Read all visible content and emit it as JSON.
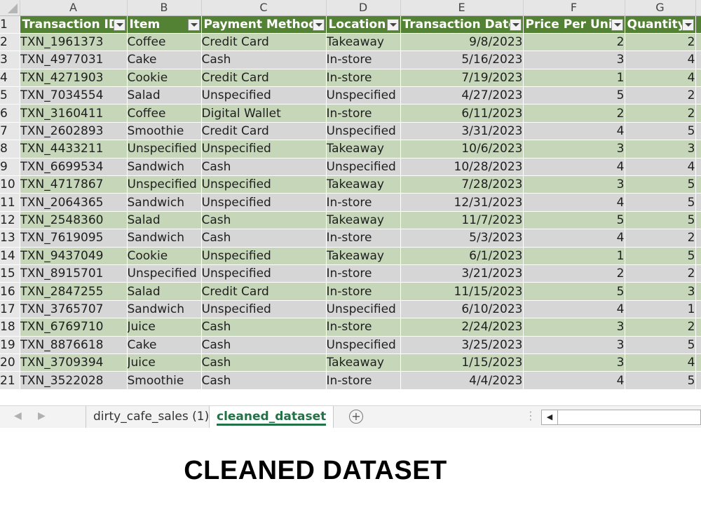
{
  "column_letters": [
    "A",
    "B",
    "C",
    "D",
    "E",
    "F",
    "G"
  ],
  "headers": [
    "Transaction ID",
    "Item",
    "Payment Method",
    "Location",
    "Transaction Date",
    "Price Per Unit",
    "Quantity"
  ],
  "row_numbers": [
    "1",
    "2",
    "3",
    "4",
    "5",
    "6",
    "7",
    "8",
    "9",
    "10",
    "11",
    "12",
    "13",
    "14",
    "15",
    "16",
    "17",
    "18",
    "19",
    "20",
    "21"
  ],
  "rows": [
    [
      "TXN_1961373",
      "Coffee",
      "Credit Card",
      "Takeaway",
      "9/8/2023",
      "2",
      "2"
    ],
    [
      "TXN_4977031",
      "Cake",
      "Cash",
      "In-store",
      "5/16/2023",
      "3",
      "4"
    ],
    [
      "TXN_4271903",
      "Cookie",
      "Credit Card",
      "In-store",
      "7/19/2023",
      "1",
      "4"
    ],
    [
      "TXN_7034554",
      "Salad",
      "Unspecified",
      "Unspecified",
      "4/27/2023",
      "5",
      "2"
    ],
    [
      "TXN_3160411",
      "Coffee",
      "Digital Wallet",
      "In-store",
      "6/11/2023",
      "2",
      "2"
    ],
    [
      "TXN_2602893",
      "Smoothie",
      "Credit Card",
      "Unspecified",
      "3/31/2023",
      "4",
      "5"
    ],
    [
      "TXN_4433211",
      "Unspecified",
      "Unspecified",
      "Takeaway",
      "10/6/2023",
      "3",
      "3"
    ],
    [
      "TXN_6699534",
      "Sandwich",
      "Cash",
      "Unspecified",
      "10/28/2023",
      "4",
      "4"
    ],
    [
      "TXN_4717867",
      "Unspecified",
      "Unspecified",
      "Takeaway",
      "7/28/2023",
      "3",
      "5"
    ],
    [
      "TXN_2064365",
      "Sandwich",
      "Unspecified",
      "In-store",
      "12/31/2023",
      "4",
      "5"
    ],
    [
      "TXN_2548360",
      "Salad",
      "Cash",
      "Takeaway",
      "11/7/2023",
      "5",
      "5"
    ],
    [
      "TXN_7619095",
      "Sandwich",
      "Cash",
      "In-store",
      "5/3/2023",
      "4",
      "2"
    ],
    [
      "TXN_9437049",
      "Cookie",
      "Unspecified",
      "Takeaway",
      "6/1/2023",
      "1",
      "5"
    ],
    [
      "TXN_8915701",
      "Unspecified",
      "Unspecified",
      "In-store",
      "3/21/2023",
      "2",
      "2"
    ],
    [
      "TXN_2847255",
      "Salad",
      "Credit Card",
      "In-store",
      "11/15/2023",
      "5",
      "3"
    ],
    [
      "TXN_3765707",
      "Sandwich",
      "Unspecified",
      "Unspecified",
      "6/10/2023",
      "4",
      "1"
    ],
    [
      "TXN_6769710",
      "Juice",
      "Cash",
      "In-store",
      "2/24/2023",
      "3",
      "2"
    ],
    [
      "TXN_8876618",
      "Cake",
      "Cash",
      "Unspecified",
      "3/25/2023",
      "3",
      "5"
    ],
    [
      "TXN_3709394",
      "Juice",
      "Cash",
      "Takeaway",
      "1/15/2023",
      "3",
      "4"
    ],
    [
      "TXN_3522028",
      "Smoothie",
      "Cash",
      "In-store",
      "4/4/2023",
      "4",
      "5"
    ]
  ],
  "tabs": {
    "sheet1": "dirty_cafe_sales (1)",
    "sheet2": "cleaned_dataset",
    "add_icon": "plus-circle-icon"
  },
  "caption": "CLEANED DATASET",
  "colors": {
    "header_green": "#548235",
    "band_green": "#c6d6b9",
    "band_gray": "#d6d6d6",
    "active_tab": "#217346"
  }
}
